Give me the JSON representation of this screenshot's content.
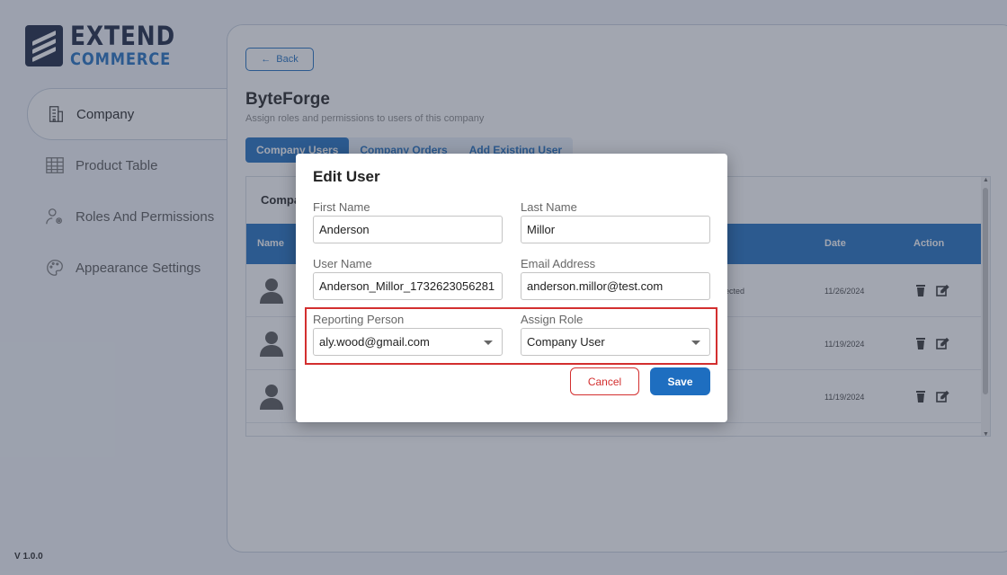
{
  "brand": {
    "line1": "EXTEND",
    "line2": "COMMERCE"
  },
  "sidebar": {
    "items": [
      {
        "label": "Company",
        "icon": "building-icon",
        "active": true
      },
      {
        "label": "Product Table",
        "icon": "table-icon",
        "active": false
      },
      {
        "label": "Roles And Permissions",
        "icon": "user-gear-icon",
        "active": false
      },
      {
        "label": "Appearance Settings",
        "icon": "palette-icon",
        "active": false
      }
    ],
    "version": "V 1.0.0"
  },
  "page": {
    "back_label": "Back",
    "title": "ByteForge",
    "subtitle": "Assign roles and permissions to users of this company",
    "tabs": [
      "Company Users",
      "Company Orders",
      "Add Existing User"
    ],
    "active_tab": "Company Users"
  },
  "table": {
    "title": "Compa",
    "columns": [
      "Name",
      "Date",
      "Action"
    ],
    "rows": [
      {
        "status": "lected",
        "date": "11/26/2024"
      },
      {
        "status": "",
        "date": "11/19/2024"
      },
      {
        "status": "",
        "date": "11/19/2024"
      }
    ]
  },
  "modal": {
    "title": "Edit User",
    "first_name_label": "First Name",
    "first_name_value": "Anderson",
    "last_name_label": "Last Name",
    "last_name_value": "Millor",
    "username_label": "User Name",
    "username_value": "Anderson_Millor_1732623056281",
    "email_label": "Email Address",
    "email_value": "anderson.millor@test.com",
    "reporting_label": "Reporting Person",
    "reporting_value": "aly.wood@gmail.com",
    "role_label": "Assign Role",
    "role_value": "Company User",
    "cancel_label": "Cancel",
    "save_label": "Save"
  },
  "colors": {
    "accent": "#1e6ec0",
    "danger": "#d32f2f",
    "brand_dark": "#16213e"
  }
}
